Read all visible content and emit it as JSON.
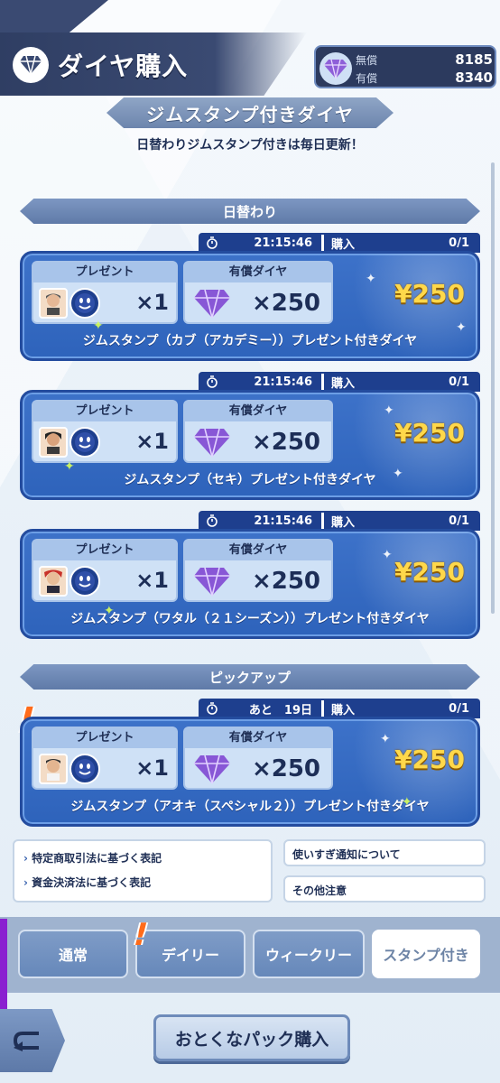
{
  "header": {
    "title": "ダイヤ購入",
    "wallet": {
      "free_label": "無償",
      "free_value": "8185",
      "paid_label": "有償",
      "paid_value": "8340"
    }
  },
  "section": {
    "title": "ジムスタンプ付きダイヤ",
    "subtitle": "日替わりジムスタンプ付きは毎日更新！"
  },
  "categories": {
    "daily": "日替わり",
    "pickup": "ピックアップ"
  },
  "cards": [
    {
      "time": "21:15:46",
      "buy_label": "購入",
      "count": "0/1",
      "present_label": "プレゼント",
      "present_qty": "×1",
      "diamond_label": "有償ダイヤ",
      "diamond_qty": "×250",
      "price": "¥250",
      "desc": "ジムスタンプ（カブ（アカデミー））プレゼント付きダイヤ"
    },
    {
      "time": "21:15:46",
      "buy_label": "購入",
      "count": "0/1",
      "present_label": "プレゼント",
      "present_qty": "×1",
      "diamond_label": "有償ダイヤ",
      "diamond_qty": "×250",
      "price": "¥250",
      "desc": "ジムスタンプ（セキ）プレゼント付きダイヤ"
    },
    {
      "time": "21:15:46",
      "buy_label": "購入",
      "count": "0/1",
      "present_label": "プレゼント",
      "present_qty": "×1",
      "diamond_label": "有償ダイヤ",
      "diamond_qty": "×250",
      "price": "¥250",
      "desc": "ジムスタンプ（ワタル（２１シーズン））プレゼント付きダイヤ"
    },
    {
      "time": "あと　19日",
      "buy_label": "購入",
      "count": "0/1",
      "present_label": "プレゼント",
      "present_qty": "×1",
      "diamond_label": "有償ダイヤ",
      "diamond_qty": "×250",
      "price": "¥250",
      "desc": "ジムスタンプ（アオキ（スペシャル２））プレゼント付きダイヤ"
    }
  ],
  "info": {
    "left1": "特定商取引法に基づく表記",
    "left2": "資金決済法に基づく表記",
    "right1": "使いすぎ通知について",
    "right2": "その他注意"
  },
  "tabs": [
    "通常",
    "デイリー",
    "ウィークリー",
    "スタンプ付き"
  ],
  "footer": {
    "pack_label": "おとくなパック購入"
  }
}
